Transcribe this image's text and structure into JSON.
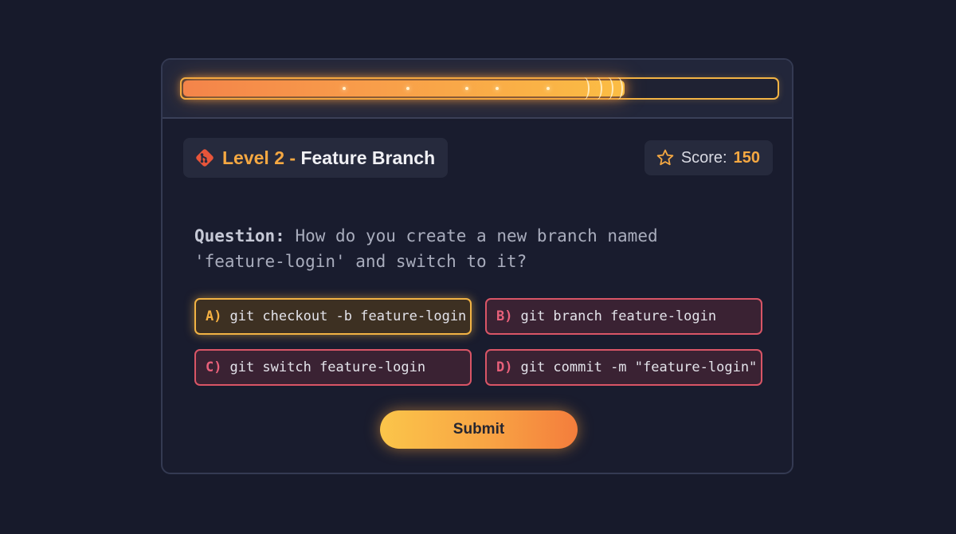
{
  "progress": {
    "fraction": 0.745
  },
  "level": {
    "prefix": "Level 2 -",
    "name": "Feature Branch",
    "icon": "git-icon"
  },
  "score": {
    "label": "Score:",
    "value": "150",
    "icon": "star-icon"
  },
  "question": {
    "label": "Question:",
    "text": "How do you create a new branch named 'feature-login' and switch to it?"
  },
  "options": [
    {
      "letter": "A)",
      "text": "git checkout -b feature-login",
      "selected": true
    },
    {
      "letter": "B)",
      "text": "git branch feature-login",
      "selected": false
    },
    {
      "letter": "C)",
      "text": "git switch feature-login",
      "selected": false
    },
    {
      "letter": "D)",
      "text": "git commit -m \"feature-login\"",
      "selected": false
    }
  ],
  "submit_label": "Submit",
  "colors": {
    "accent": "#f5a842",
    "wrong": "#d95566",
    "selected": "#f2b344",
    "background": "#171a2b"
  }
}
